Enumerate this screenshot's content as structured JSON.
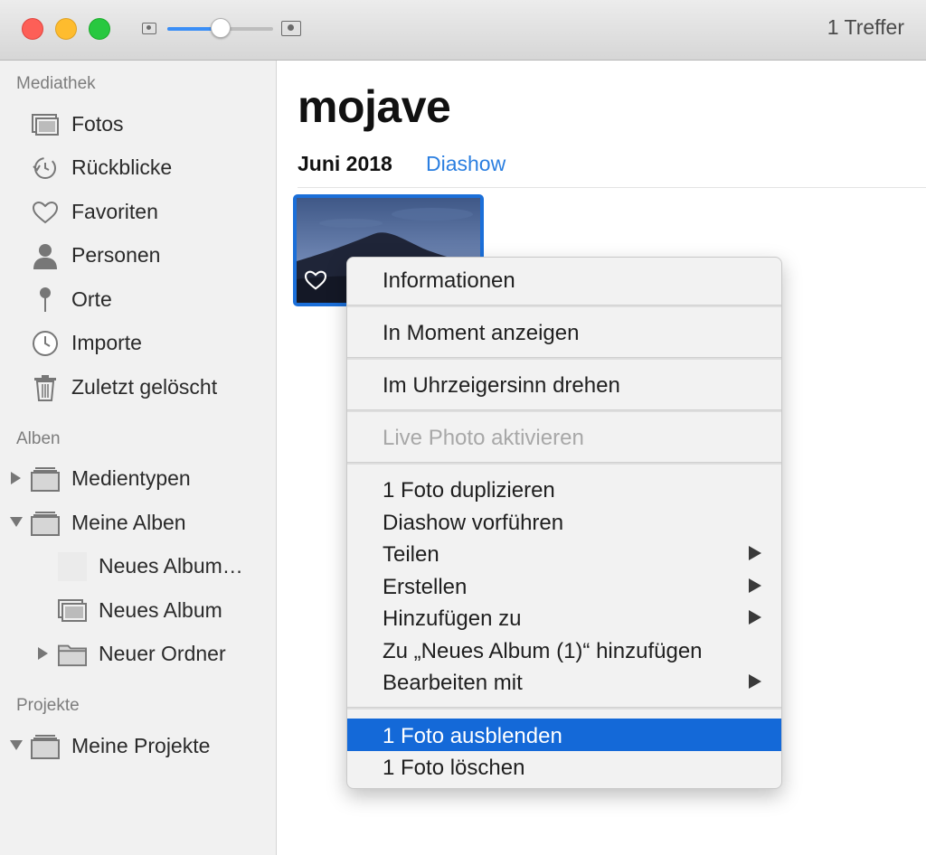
{
  "toolbar": {
    "match_count": "1 Treffer",
    "zoom_slider_value": 0.5,
    "accent_color": "#3a8ef6"
  },
  "sidebar": {
    "library_title": "Mediathek",
    "library_items": [
      {
        "label": "Fotos",
        "icon": "photos-icon"
      },
      {
        "label": "Rückblicke",
        "icon": "memories-icon"
      },
      {
        "label": "Favoriten",
        "icon": "heart-icon"
      },
      {
        "label": "Personen",
        "icon": "person-icon"
      },
      {
        "label": "Orte",
        "icon": "pin-icon"
      },
      {
        "label": "Importe",
        "icon": "clock-icon"
      },
      {
        "label": "Zuletzt gelöscht",
        "icon": "trash-icon"
      }
    ],
    "albums_title": "Alben",
    "album_items": [
      {
        "label": "Medientypen",
        "icon": "album-icon",
        "disclosure": "collapsed"
      },
      {
        "label": "Meine Alben",
        "icon": "album-icon",
        "disclosure": "expanded"
      },
      {
        "label": "Neues Album…",
        "icon": "empty-album-icon"
      },
      {
        "label": "Neues Album",
        "icon": "album-icon"
      },
      {
        "label": "Neuer Ordner",
        "icon": "folder-icon",
        "disclosure": "collapsed"
      }
    ],
    "projects_title": "Projekte",
    "project_items": [
      {
        "label": "Meine Projekte",
        "icon": "album-icon",
        "disclosure": "expanded"
      }
    ]
  },
  "main": {
    "title": "mojave",
    "moment_date": "Juni 2018",
    "slideshow_link": "Diashow",
    "link_color": "#2a7ee0",
    "selection_color": "#1b6fd9"
  },
  "context_menu": {
    "groups": [
      [
        {
          "label": "Informationen"
        }
      ],
      [
        {
          "label": "In Moment anzeigen"
        }
      ],
      [
        {
          "label": "Im Uhrzeigersinn drehen"
        }
      ],
      [
        {
          "label": "Live Photo aktivieren",
          "disabled": true
        }
      ],
      [
        {
          "label": "1 Foto duplizieren"
        },
        {
          "label": "Diashow vorführen"
        },
        {
          "label": "Teilen",
          "submenu": true
        },
        {
          "label": "Erstellen",
          "submenu": true
        },
        {
          "label": "Hinzufügen zu",
          "submenu": true
        },
        {
          "label": "Zu „Neues Album (1)“ hinzufügen"
        },
        {
          "label": "Bearbeiten mit",
          "submenu": true
        }
      ],
      [
        {
          "label": "1 Foto ausblenden",
          "selected": true
        },
        {
          "label": "1 Foto löschen"
        }
      ]
    ],
    "highlight_color": "#1469d8"
  }
}
